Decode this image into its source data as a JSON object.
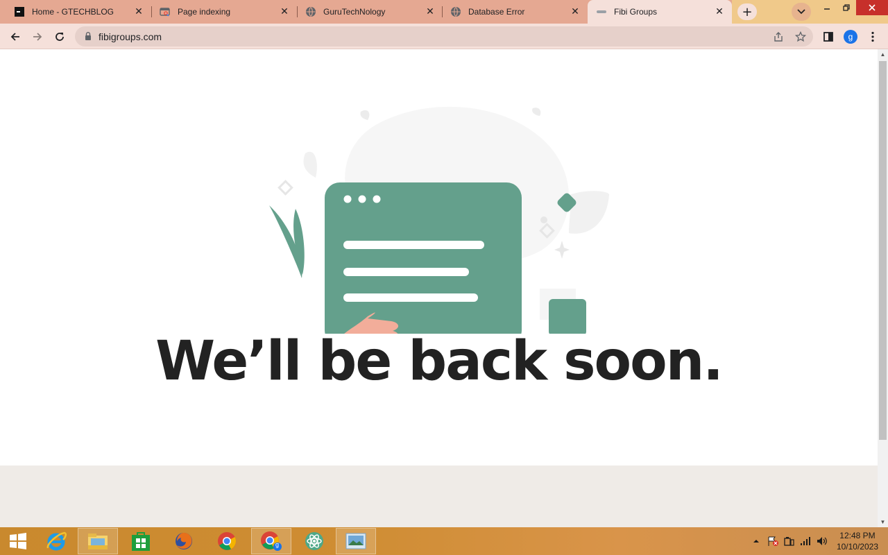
{
  "browser": {
    "tabs": [
      {
        "title": "Home - GTECHBLOG",
        "icon": "gtechblog-favicon"
      },
      {
        "title": "Page indexing",
        "icon": "search-console-favicon"
      },
      {
        "title": "GuruTechNology",
        "icon": "globe-icon"
      },
      {
        "title": "Database Error",
        "icon": "globe-icon"
      },
      {
        "title": "Fibi Groups",
        "icon": "fibi-favicon",
        "active": true
      }
    ],
    "new_tab_label": "+",
    "url": "fibigroups.com",
    "profile_initial": "g"
  },
  "page": {
    "headline": "We’ll be back soon.",
    "accent_color": "#64a08c",
    "hand_color": "#f2ad9a",
    "text_color": "#222222",
    "footer_color": "#efebe7"
  },
  "taskbar": {
    "apps": [
      "start-button",
      "internet-explorer-icon",
      "file-explorer-icon",
      "store-icon",
      "firefox-icon",
      "chrome-icon",
      "chrome-profile-icon",
      "atom-icon",
      "photos-icon"
    ],
    "chrome_badge": "g",
    "time": "12:48 PM",
    "date": "10/10/2023"
  }
}
